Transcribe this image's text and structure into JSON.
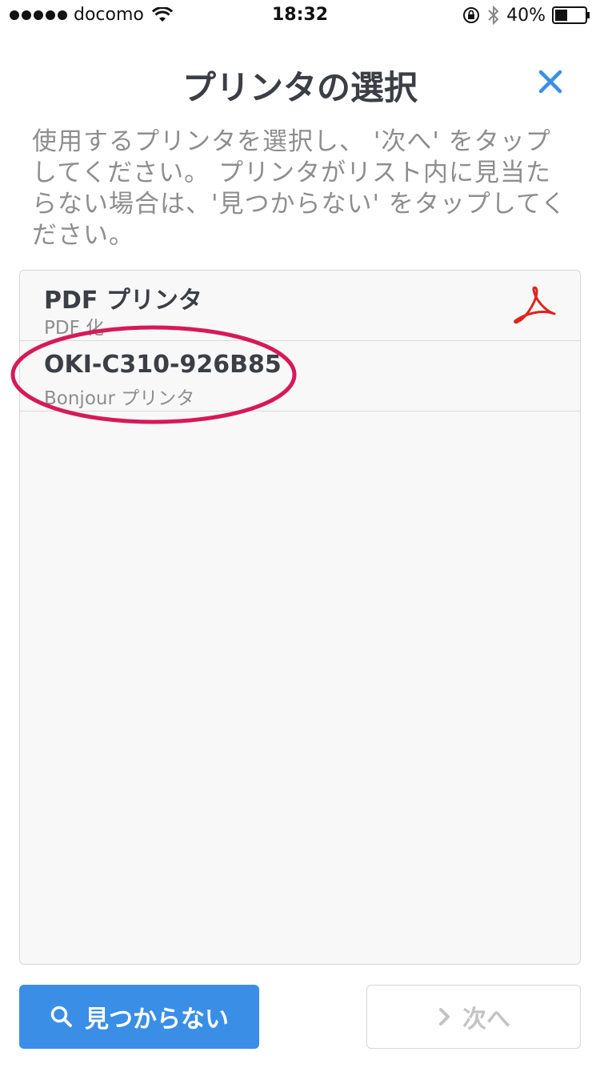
{
  "status_bar": {
    "carrier": "docomo",
    "time": "18:32",
    "battery": "40%"
  },
  "header": {
    "title": "プリンタの選択"
  },
  "instructions": "使用するプリンタを選択し、 '次へ' をタップしてください。 プリンタがリスト内に見当たらない場合は、'見つからない' をタップしてください。",
  "printers": [
    {
      "name": "PDF プリンタ",
      "subtitle": "PDF 化"
    },
    {
      "name": "OKI-C310-926B85",
      "subtitle": "Bonjour プリンタ"
    }
  ],
  "buttons": {
    "not_found_label": "見つからない",
    "next_label": "次へ"
  },
  "colors": {
    "accent": "#3a8ee6",
    "highlight": "#d6195a",
    "pdf_red": "#e0231d"
  }
}
